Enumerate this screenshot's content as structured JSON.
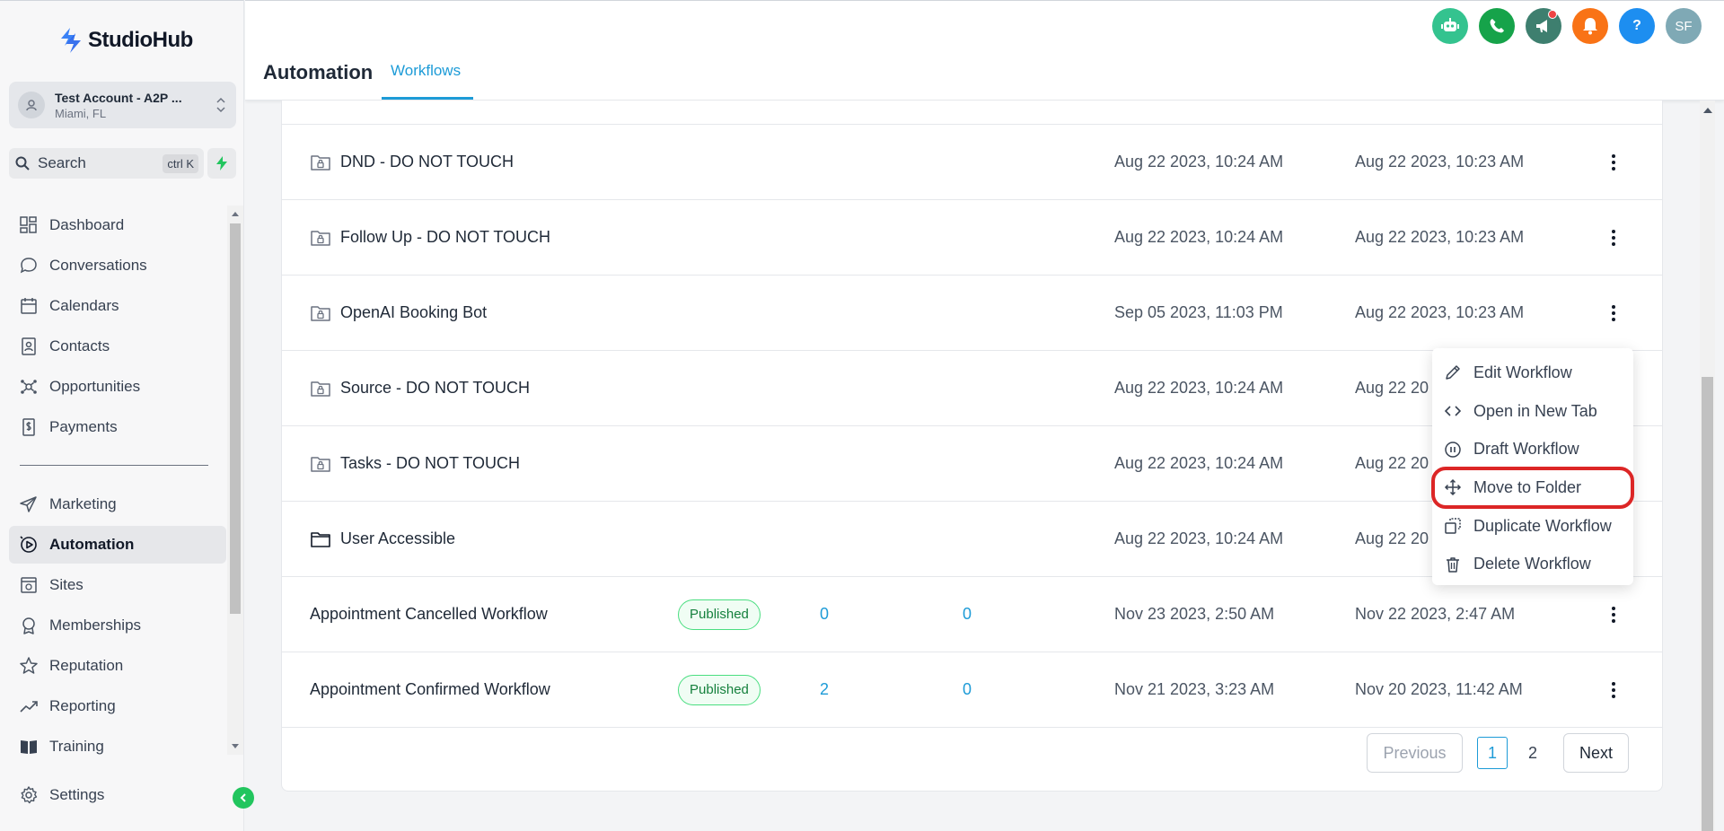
{
  "brand": {
    "name": "StudioHub"
  },
  "account": {
    "name": "Test Account - A2P ...",
    "location": "Miami, FL"
  },
  "search": {
    "label": "Search",
    "shortcut": "ctrl K"
  },
  "sidebar": {
    "items": [
      {
        "label": "Dashboard",
        "icon": "dashboard-icon"
      },
      {
        "label": "Conversations",
        "icon": "chat-icon"
      },
      {
        "label": "Calendars",
        "icon": "calendar-icon"
      },
      {
        "label": "Contacts",
        "icon": "contacts-icon"
      },
      {
        "label": "Opportunities",
        "icon": "opportunities-icon"
      },
      {
        "label": "Payments",
        "icon": "payments-icon"
      },
      {
        "label": "Marketing",
        "icon": "send-icon"
      },
      {
        "label": "Automation",
        "icon": "automation-icon",
        "active": true
      },
      {
        "label": "Sites",
        "icon": "sites-icon"
      },
      {
        "label": "Memberships",
        "icon": "memberships-icon"
      },
      {
        "label": "Reputation",
        "icon": "star-icon"
      },
      {
        "label": "Reporting",
        "icon": "chart-icon"
      },
      {
        "label": "Training",
        "icon": "book-icon"
      },
      {
        "label": "Settings",
        "icon": "gear-icon"
      }
    ]
  },
  "header": {
    "title": "Automation",
    "tabs": [
      {
        "label": "Workflows",
        "active": true
      }
    ],
    "avatar_initials": "SF",
    "help_label": "?"
  },
  "table": {
    "rows": [
      {
        "name": "DND - DO NOT TOUCH",
        "type": "locked-folder",
        "date1": "Aug 22 2023, 10:24 AM",
        "date2": "Aug 22 2023, 10:23 AM"
      },
      {
        "name": "Follow Up - DO NOT TOUCH",
        "type": "locked-folder",
        "date1": "Aug 22 2023, 10:24 AM",
        "date2": "Aug 22 2023, 10:23 AM"
      },
      {
        "name": "OpenAI Booking Bot",
        "type": "locked-folder",
        "date1": "Sep 05 2023, 11:03 PM",
        "date2": "Aug 22 2023, 10:23 AM"
      },
      {
        "name": "Source - DO NOT TOUCH",
        "type": "locked-folder",
        "date1": "Aug 22 2023, 10:24 AM",
        "date2": "Aug 22 20"
      },
      {
        "name": "Tasks - DO NOT TOUCH",
        "type": "locked-folder",
        "date1": "Aug 22 2023, 10:24 AM",
        "date2": "Aug 22 20"
      },
      {
        "name": "User Accessible",
        "type": "folder",
        "date1": "Aug 22 2023, 10:24 AM",
        "date2": "Aug 22 20"
      },
      {
        "name": "Appointment Cancelled Workflow",
        "type": "workflow",
        "status": "Published",
        "enrolled": "0",
        "completed": "0",
        "date1": "Nov 23 2023, 2:50 AM",
        "date2": "Nov 22 2023, 2:47 AM"
      },
      {
        "name": "Appointment Confirmed Workflow",
        "type": "workflow",
        "status": "Published",
        "enrolled": "2",
        "completed": "0",
        "date1": "Nov 21 2023, 3:23 AM",
        "date2": "Nov 20 2023, 11:42 AM"
      }
    ]
  },
  "pagination": {
    "previous": "Previous",
    "pages": [
      "1",
      "2"
    ],
    "current": "1",
    "next": "Next"
  },
  "context_menu": {
    "items": [
      {
        "label": "Edit Workflow",
        "icon": "pencil-icon"
      },
      {
        "label": "Open in New Tab",
        "icon": "code-icon"
      },
      {
        "label": "Draft Workflow",
        "icon": "pause-icon"
      },
      {
        "label": "Move to Folder",
        "icon": "move-icon",
        "highlighted": true
      },
      {
        "label": "Duplicate Workflow",
        "icon": "duplicate-icon"
      },
      {
        "label": "Delete Workflow",
        "icon": "trash-icon"
      }
    ]
  },
  "colors": {
    "accent": "#1d9bd7",
    "published": "#15803d",
    "highlight": "#dc2626"
  }
}
